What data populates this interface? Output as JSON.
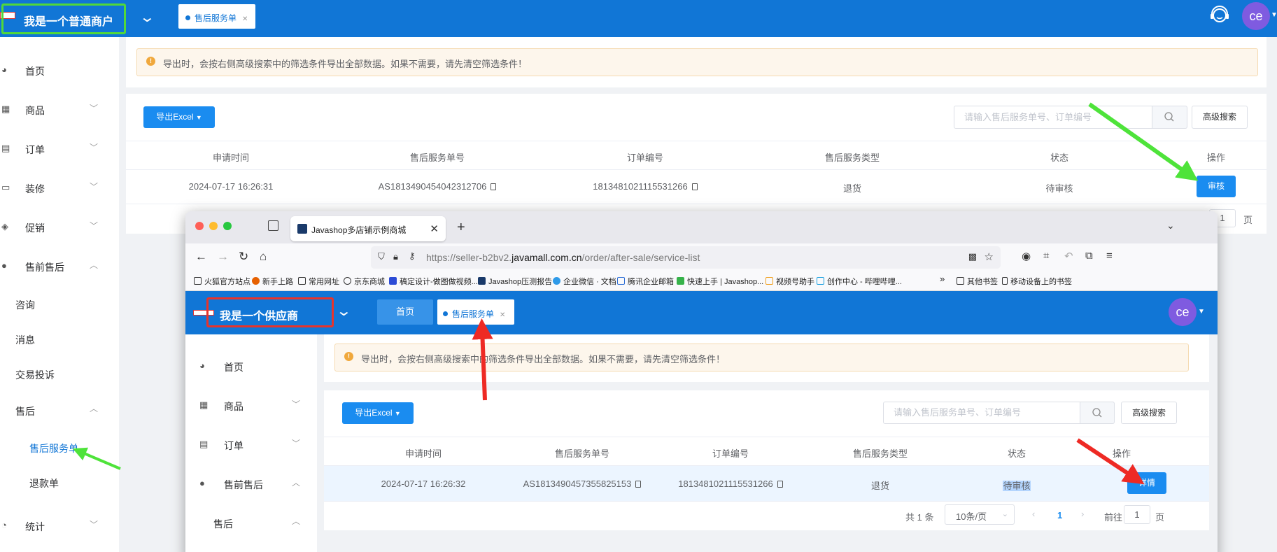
{
  "merchant": {
    "shop_name": "我是一个普通商户",
    "tab_label": "售后服务单",
    "avatar": "ce",
    "sidebar": [
      {
        "label": "首页",
        "icon": "dashboard-icon"
      },
      {
        "label": "商品",
        "icon": "goods-icon"
      },
      {
        "label": "订单",
        "icon": "order-icon"
      },
      {
        "label": "装修",
        "icon": "decoration-icon"
      },
      {
        "label": "促销",
        "icon": "promotion-icon"
      },
      {
        "label": "售前售后",
        "icon": "user-icon"
      }
    ],
    "sidebar_sub": [
      "咨询",
      "消息",
      "交易投诉",
      "售后",
      "售后服务单",
      "退款单"
    ],
    "sidebar_stats": "统计",
    "alert": "导出时，会按右侧高级搜索中的筛选条件导出全部数据。如果不需要，请先清空筛选条件！",
    "export_button": "导出Excel",
    "search_placeholder": "请输入售后服务单号、订单编号",
    "advanced_search": "高级搜索",
    "columns": [
      "申请时间",
      "售后服务单号",
      "订单编号",
      "售后服务类型",
      "状态",
      "操作"
    ],
    "row": {
      "time": "2024-07-17 16:26:31",
      "service_no": "AS1813490454042312706",
      "order_no": "1813481021115531266",
      "type": "退货",
      "status": "待审核",
      "action": "审核"
    },
    "page_input": "1",
    "page_suffix": "页"
  },
  "browser": {
    "tab_title": "Javashop多店铺示例商城",
    "url_prefix": "https://seller-b2bv2.",
    "url_domain": "javamall.com.cn",
    "url_path": "/order/after-sale/service-list",
    "bookmarks": [
      "火狐官方站点",
      "新手上路",
      "常用网址",
      "京东商城",
      "稿定设计-做图做视频...",
      "Javashop压测报告",
      "企业微信 · 文档",
      "腾讯企业邮箱",
      "快速上手 | Javashop...",
      "视频号助手",
      "创作中心 - 哔哩哔哩..."
    ],
    "bookmarks_right": [
      "其他书签",
      "移动设备上的书签"
    ]
  },
  "supplier": {
    "shop_name": "我是一个供应商",
    "home_tab": "首页",
    "tab_label": "售后服务单",
    "avatar": "ce",
    "sidebar": [
      {
        "label": "首页",
        "icon": "dashboard-icon"
      },
      {
        "label": "商品",
        "icon": "goods-icon"
      },
      {
        "label": "订单",
        "icon": "order-icon"
      },
      {
        "label": "售前售后",
        "icon": "user-icon"
      }
    ],
    "sidebar_sub": "售后",
    "alert": "导出时，会按右侧高级搜索中的筛选条件导出全部数据。如果不需要，请先清空筛选条件！",
    "export_button": "导出Excel",
    "search_placeholder": "请输入售后服务单号、订单编号",
    "advanced_search": "高级搜索",
    "columns": [
      "申请时间",
      "售后服务单号",
      "订单编号",
      "售后服务类型",
      "状态",
      "操作"
    ],
    "row": {
      "time": "2024-07-17 16:26:32",
      "service_no": "AS1813490457355825153",
      "order_no": "1813481021115531266",
      "type": "退货",
      "status": "待审核",
      "action": "详情"
    },
    "pager": {
      "total": "共 1 条",
      "page_size": "10条/页",
      "current": "1",
      "goto": "前往",
      "goto_value": "1",
      "suffix": "页"
    }
  },
  "colors": {
    "header_blue": "#1176d6",
    "primary": "#1a8cf0",
    "green_annotation": "#4ee33a",
    "red_annotation": "#ee2a24"
  }
}
